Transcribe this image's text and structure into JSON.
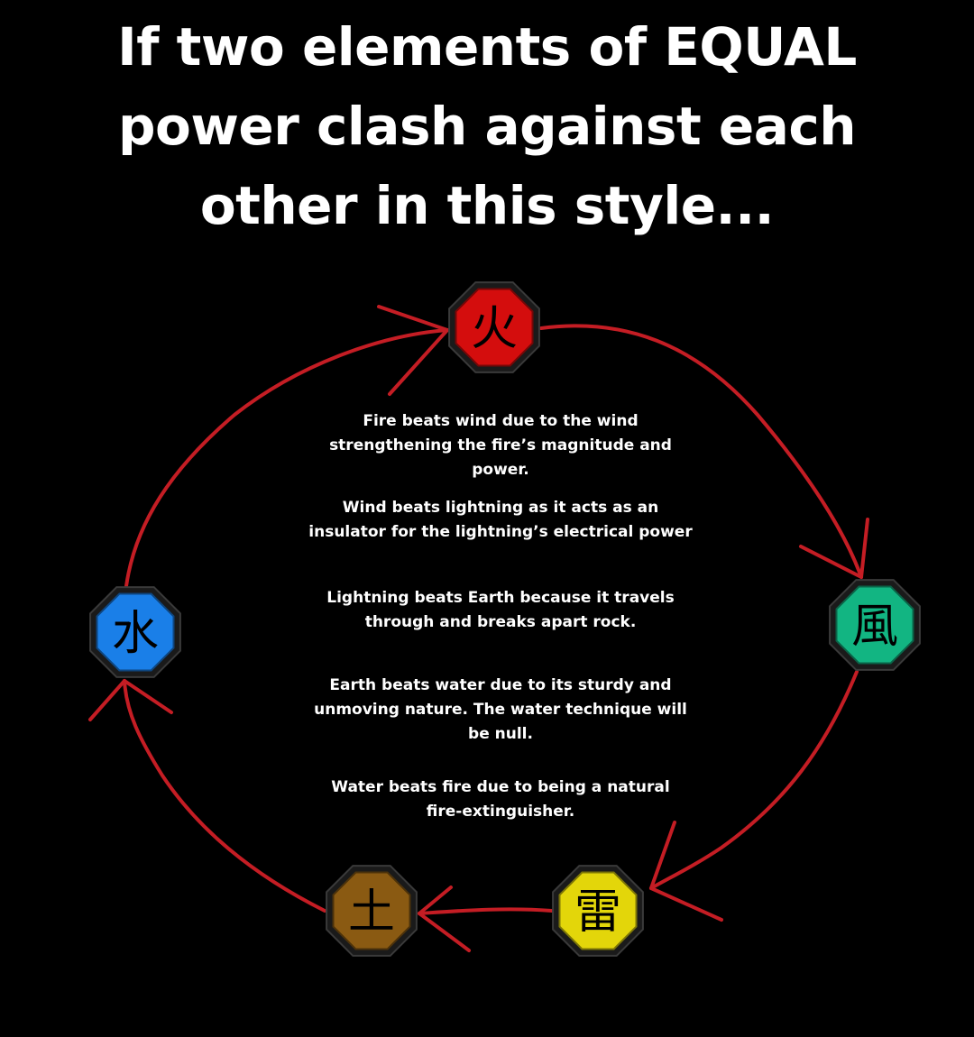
{
  "title": {
    "lines": [
      "If two elements of EQUAL",
      "power clash against each",
      "other in this style..."
    ]
  },
  "elements": {
    "fire": {
      "symbol": "火",
      "color": "#d40d0d"
    },
    "wind": {
      "symbol": "風",
      "color": "#12b582"
    },
    "lightning": {
      "symbol": "雷",
      "color": "#e3d60a"
    },
    "earth": {
      "symbol": "土",
      "color": "#8a5a12"
    },
    "water": {
      "symbol": "水",
      "color": "#1a7fe8"
    }
  },
  "arrow_color": "#c41d24",
  "descriptions": [
    {
      "text": "Fire beats wind due to the wind strengthening the fire’s magnitude and power."
    },
    {
      "text": "Wind beats lightning as it acts as an insulator for the lightning’s electrical power"
    },
    {
      "text": "Lightning beats Earth because it travels through and breaks apart rock."
    },
    {
      "text": "Earth beats water due to its sturdy and unmoving nature. The water technique will be null."
    },
    {
      "text": "Water beats fire due to being a natural fire-extinguisher."
    }
  ]
}
